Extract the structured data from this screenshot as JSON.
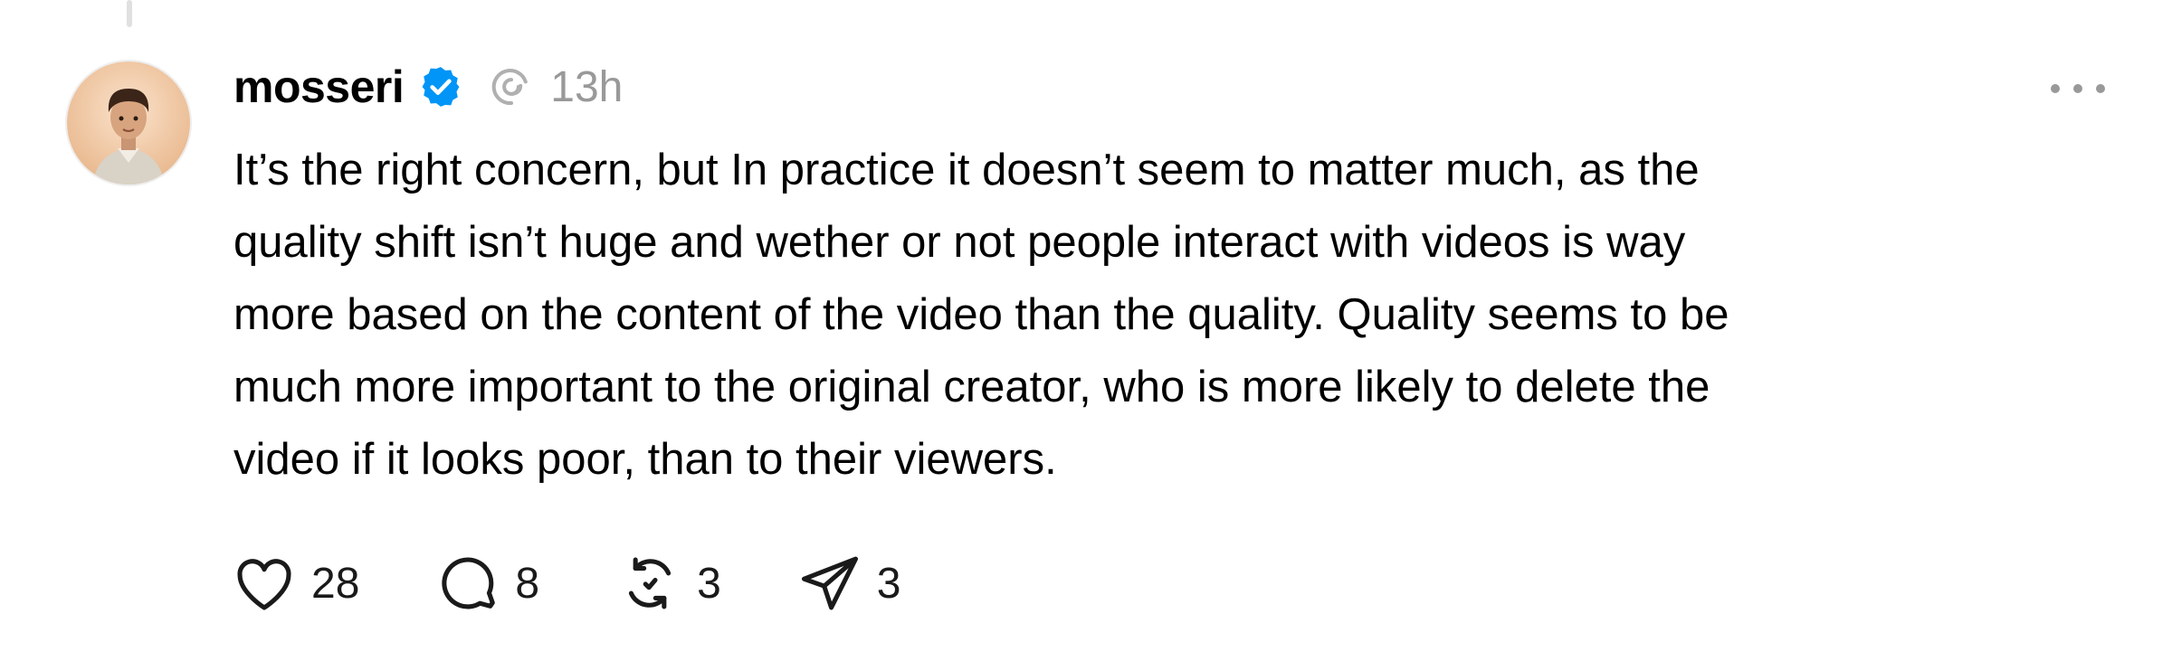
{
  "post": {
    "username": "mosseri",
    "timestamp": "13h",
    "body_lines": [
      "It’s the right concern, but In practice it doesn’t seem to matter much, as the",
      "quality shift isn’t huge and wether or not people interact with videos is way",
      "more based on the content of the video than the quality. Quality seems to be",
      "much more important to the original creator, who is more likely to delete the",
      "video if it looks poor, than to their viewers."
    ],
    "actions": {
      "likes": "28",
      "replies": "8",
      "reposts": "3",
      "shares": "3"
    }
  },
  "icons": {
    "verified": "verified-badge-icon",
    "thread": "threads-logo-icon",
    "more": "more-options-icon",
    "like": "heart-icon",
    "reply": "comment-bubble-icon",
    "repost": "repost-icon",
    "share": "send-icon"
  },
  "colors": {
    "verified_blue": "#0095f6",
    "muted_gray": "#999999",
    "text": "#000000"
  }
}
